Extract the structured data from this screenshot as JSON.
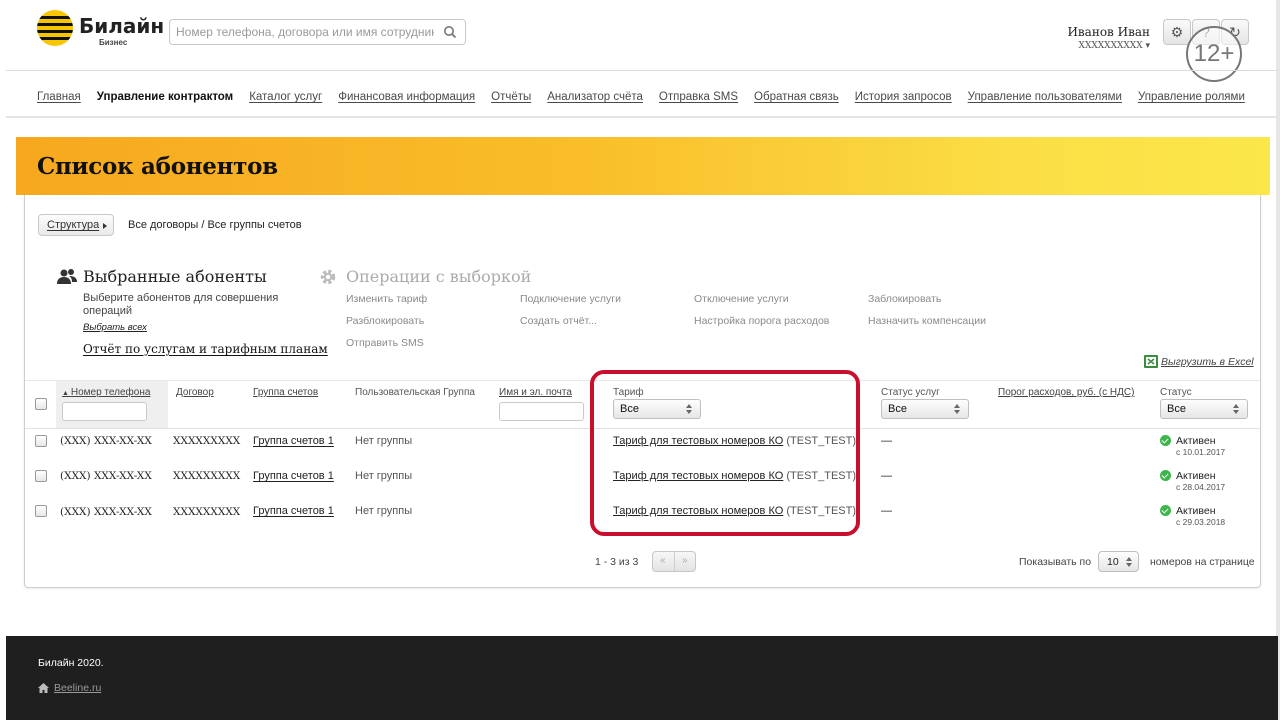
{
  "header": {
    "logo_name": "Билайн",
    "logo_sub": "Бизнес",
    "search_placeholder": "Номер телефона, договора или имя сотрудника",
    "user_name": "Иванов Иван",
    "user_account": "XXXXXXXXXX ▾",
    "age_badge": "12+"
  },
  "nav": [
    "Главная",
    "Управление контрактом",
    "Каталог услуг",
    "Финансовая информация",
    "Отчёты",
    "Анализатор счёта",
    "Отправка SMS",
    "Обратная связь",
    "История запросов",
    "Управление пользователями",
    "Управление ролями"
  ],
  "nav_active": "Управление контрактом",
  "page_title": "Список абонентов",
  "breadcrumb": {
    "struct_button": "Структура",
    "path": "Все договоры  /  Все группы счетов"
  },
  "selected": {
    "title": "Выбранные абоненты",
    "description": "Выберите абонентов для совершения операций",
    "select_all": "Выбрать всех",
    "report_link": "Отчёт по услугам и тарифным планам"
  },
  "operations": {
    "title": "Операции с выборкой",
    "items": [
      "Изменить тариф",
      "Подключение услуги",
      "Отключение услуги",
      "Заблокировать",
      "Разблокировать",
      "Создать отчёт...",
      "Настройка порога расходов",
      "Назначить компенсации",
      "Отправить SMS"
    ]
  },
  "export_excel": "Выгрузить в Excel",
  "table": {
    "headers": {
      "phone": "Номер телефона",
      "contract": "Договор",
      "account_group": "Группа счетов",
      "user_group": "Пользовательская Группа",
      "name_email": "Имя и эл. почта",
      "tariff": "Тариф",
      "service_status": "Статус услуг",
      "threshold": "Порог расходов, руб. (с НДС)",
      "status": "Статус"
    },
    "filter_all": "Все",
    "rows": [
      {
        "phone": "(XXX) XXX-XX-XX",
        "contract": "XXXXXXXXX",
        "account_group": "Группа счетов 1",
        "user_group": "Нет группы",
        "tariff": "Тариф для тестовых номеров КО",
        "tariff_code": "(TEST_TEST)",
        "service_status": "—",
        "status": "Активен",
        "since": "с 10.01.2017"
      },
      {
        "phone": "(XXX) XXX-XX-XX",
        "contract": "XXXXXXXXX",
        "account_group": "Группа счетов 1",
        "user_group": "Нет группы",
        "tariff": "Тариф для тестовых номеров КО",
        "tariff_code": "(TEST_TEST)",
        "service_status": "—",
        "status": "Активен",
        "since": "с 28.04.2017"
      },
      {
        "phone": "(XXX) XXX-XX-XX",
        "contract": "XXXXXXXXX",
        "account_group": "Группа счетов 1",
        "user_group": "Нет группы",
        "tariff": "Тариф для тестовых номеров КО",
        "tariff_code": "(TEST_TEST)",
        "service_status": "—",
        "status": "Активен",
        "since": "с 29.03.2018"
      }
    ]
  },
  "pagination": {
    "info": "1 - 3 из 3",
    "prev": "«",
    "next": "»",
    "show_label": "Показывать по",
    "per_page": "10",
    "per_label": "номеров на странице"
  },
  "footer": {
    "copyright": "Билайн 2020.",
    "link": "Beeline.ru"
  },
  "colors": {
    "brand_yellow": "#f7c600",
    "highlight_red": "#c8102e",
    "status_green": "#3cb54a",
    "footer_bg": "#1f1f1f"
  }
}
